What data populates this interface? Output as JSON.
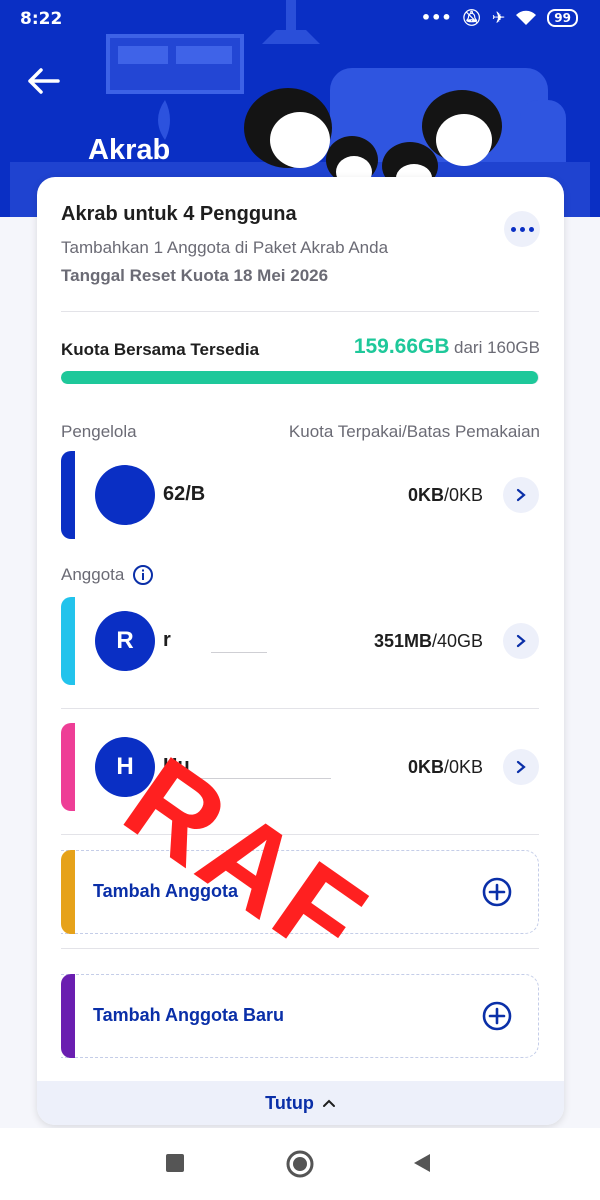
{
  "status_bar": {
    "time": "8:22",
    "dots": "•••",
    "battery": "99"
  },
  "header": {
    "title": "Akrab"
  },
  "package": {
    "title": "Akrab untuk 4 Pengguna",
    "subtitle": "Tambahkan 1 Anggota di Paket Akrab Anda",
    "reset": "Tanggal Reset Kuota 18 Mei 2026"
  },
  "quota": {
    "label": "Kuota Bersama Tersedia",
    "available": "159.66GB",
    "total": "dari 160GB",
    "fill_fraction": 0.998
  },
  "sections": {
    "manager_label": "Pengelola",
    "usage_header": "Kuota Terpakai/Batas Pemakaian",
    "members_label": "Anggota"
  },
  "manager": {
    "initial": "",
    "name": "62/B",
    "used": "0KB",
    "limit": "/0KB"
  },
  "members": [
    {
      "initial": "R",
      "name": "r",
      "used": "351MB",
      "limit": "/40GB"
    },
    {
      "initial": "H",
      "name": "Hu",
      "used": "0KB",
      "limit": "/0KB"
    }
  ],
  "add_buttons": [
    {
      "label": "Tambah Anggota"
    },
    {
      "label": "Tambah Anggota Baru"
    }
  ],
  "footer": {
    "close_label": "Tutup"
  },
  "watermark": "RAF",
  "colors": {
    "brand_blue": "#0a2fc4",
    "quota_green": "#1ec89a",
    "manager_strip": "#0a2fc4",
    "member1_strip": "#22c3ec",
    "member2_strip": "#ee3e96",
    "add1_strip": "#e6a21a",
    "add2_strip": "#6a1eb0"
  }
}
